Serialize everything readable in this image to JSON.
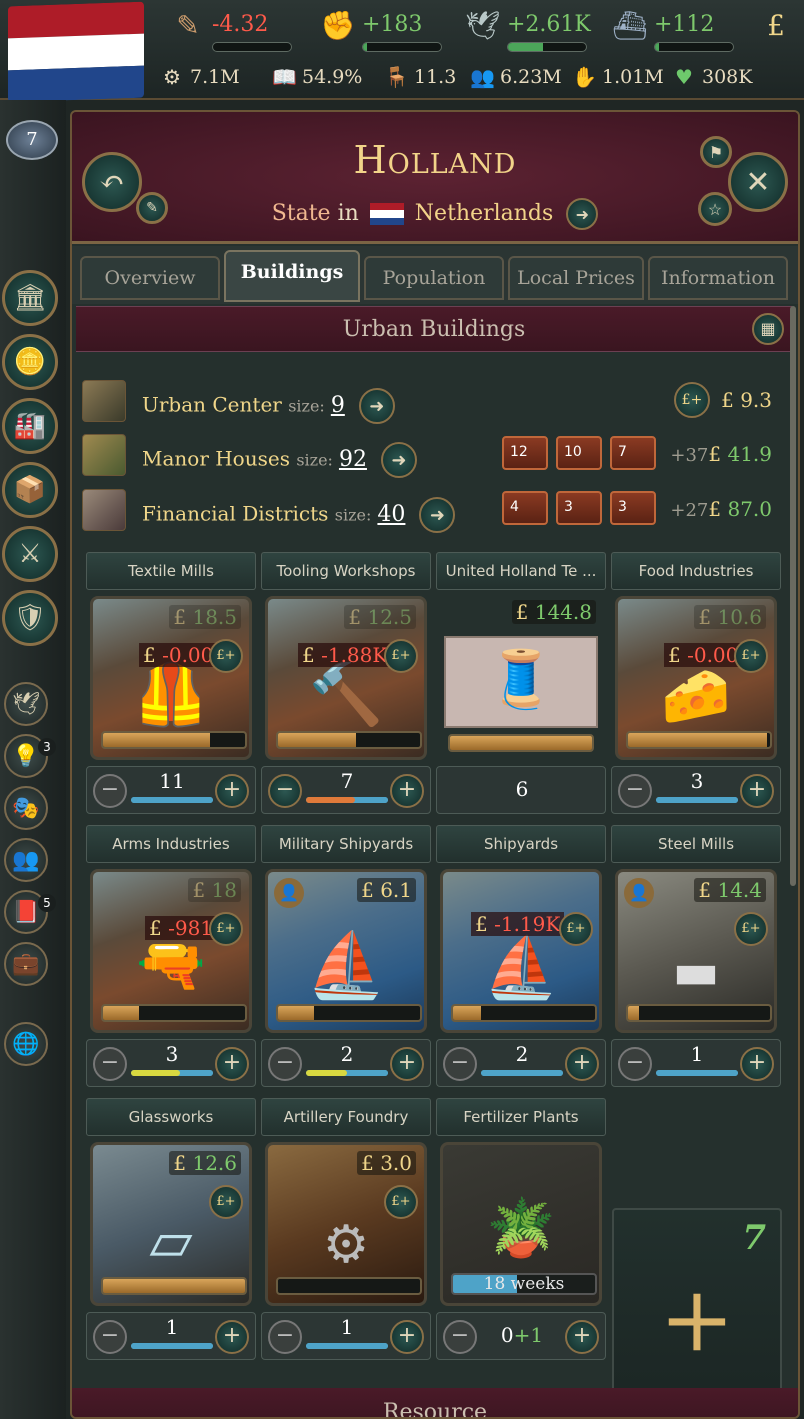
{
  "top": {
    "resources": [
      {
        "icon": "quill-icon",
        "glyph": "✎",
        "value": "-4.32",
        "color": "#ff5a4a",
        "fill": 0.0
      },
      {
        "icon": "hand-icon",
        "glyph": "✊",
        "value": "+183",
        "color": "#7ec96c",
        "fill": 0.05
      },
      {
        "icon": "dove-icon",
        "glyph": "🕊",
        "value": "+2.61K",
        "color": "#7ec96c",
        "fill": 0.45
      },
      {
        "icon": "ship-icon",
        "glyph": "⛴",
        "value": "+112",
        "color": "#7ec96c",
        "fill": 0.05
      },
      {
        "icon": "pound-icon",
        "glyph": "£",
        "value": "",
        "color": "#f0d68a",
        "fill": 0
      }
    ],
    "stats": [
      {
        "icon": "gdp-icon",
        "glyph": "⚙",
        "value": "7.1M"
      },
      {
        "icon": "literacy-icon",
        "glyph": "📖",
        "value": "54.9%"
      },
      {
        "icon": "sol-icon",
        "glyph": "🪑",
        "value": "11.3"
      },
      {
        "icon": "population-icon",
        "glyph": "👥",
        "value": "6.23M"
      },
      {
        "icon": "workforce-icon",
        "glyph": "✋",
        "value": "1.01M"
      },
      {
        "icon": "loyalty-icon",
        "glyph": "♥",
        "value": "308K"
      }
    ],
    "rank": "7"
  },
  "sidebar": {
    "badges": [
      "3",
      "5"
    ]
  },
  "header": {
    "title": "Holland",
    "state_label": "State",
    "in_label": "in",
    "country": "Netherlands"
  },
  "tabs": [
    "Overview",
    "Buildings",
    "Population",
    "Local Prices",
    "Information"
  ],
  "section_title": "Urban Buildings",
  "urban": [
    {
      "name": "Urban Center",
      "size_label": "size:",
      "size": "9",
      "cost_prefix": "",
      "cost": "9.3"
    },
    {
      "name": "Manor Houses",
      "size_label": "size:",
      "size": "92",
      "chips": [
        "12",
        "10",
        "7"
      ],
      "cost_prefix": "+37",
      "cost": "41.9"
    },
    {
      "name": "Financial Districts",
      "size_label": "size:",
      "size": "40",
      "chips": [
        "4",
        "3",
        "3"
      ],
      "cost_prefix": "+27",
      "cost": "87.0"
    }
  ],
  "buildings": [
    {
      "name": "Textile Mills",
      "price": "18.5",
      "neg": "-0.00",
      "level": "11",
      "progress": 0.75
    },
    {
      "name": "Tooling Workshops",
      "price": "12.5",
      "neg": "-1.88K",
      "level": "7",
      "progress": 0.55
    },
    {
      "name": "United Holland Te ...",
      "price": "144.8",
      "level": "6",
      "progress": 1.0
    },
    {
      "name": "Food Industries",
      "price": "10.6",
      "neg": "-0.00",
      "level": "3",
      "progress": 0.98
    },
    {
      "name": "Arms Industries",
      "price": "18",
      "neg": "-981",
      "level": "3",
      "progress": 0.25
    },
    {
      "name": "Military Shipyards",
      "price": "6.1",
      "level": "2",
      "progress": 0.25
    },
    {
      "name": "Shipyards",
      "price": "",
      "neg": "-1.19K",
      "level": "2",
      "progress": 0.2
    },
    {
      "name": "Steel Mills",
      "price": "14.4",
      "level": "1",
      "progress": 0.08
    },
    {
      "name": "Glassworks",
      "price": "12.6",
      "level": "1",
      "progress": 1.0
    },
    {
      "name": "Artillery Foundry",
      "price": "3.0",
      "level": "1",
      "progress": 0.0
    },
    {
      "name": "Fertilizer Plants",
      "construction": "18 weeks",
      "level_base": "0",
      "level_add": "+1",
      "progress": 0.45
    }
  ],
  "add_slots": "7",
  "footer_title": "Resource"
}
